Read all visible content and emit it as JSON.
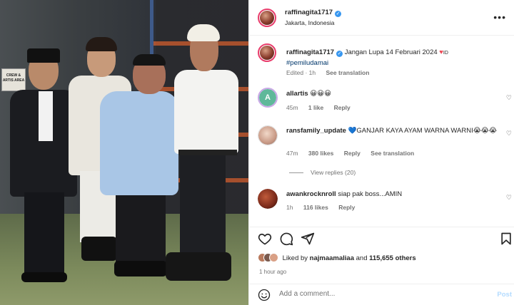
{
  "post": {
    "username": "raffinagita1717",
    "location": "Jakarta, Indonesia",
    "more_label": "•••",
    "photo_sign": "CREW & ARTIS AREA"
  },
  "caption": {
    "username": "raffinagita1717",
    "text": "Jangan Lupa 14 Februari 2024",
    "heart": "♥",
    "suffix": "ID",
    "hashtag": "#pemiludamai",
    "edited": "Edited · 1h",
    "see_translation": "See translation"
  },
  "comments": [
    {
      "username": "allartis",
      "text": "😀😀😀",
      "time": "45m",
      "likes": "1 like",
      "reply": "Reply",
      "avatar_color": "#5fb89a"
    },
    {
      "username": "ransfamily_update",
      "text": "💙GANJAR KAYA AYAM WARNA WARNI😭😭😭",
      "time": "47m",
      "likes": "380 likes",
      "reply": "Reply",
      "see_translation": "See translation",
      "view_replies": "View replies (20)",
      "avatar_color": "#d9b7a0"
    },
    {
      "username": "awankrocknroll",
      "text": "siap pak boss...AMIN",
      "time": "1h",
      "likes": "116 likes",
      "reply": "Reply",
      "avatar_color": "#8a3c2c"
    }
  ],
  "likes": {
    "prefix": "Liked by",
    "user": "najmaamaliaa",
    "and": "and",
    "count": "115,655 others"
  },
  "time_ago": "1 hour ago",
  "add_comment": {
    "placeholder": "Add a comment...",
    "post_label": "Post"
  },
  "icons": {
    "like": "heart-icon",
    "comment": "comment-icon",
    "share": "share-icon",
    "save": "bookmark-icon",
    "emoji": "emoji-icon"
  },
  "colors": {
    "verified": "#3897f0",
    "link": "#00376b",
    "muted": "#737373",
    "heart_red": "#ed4956"
  }
}
